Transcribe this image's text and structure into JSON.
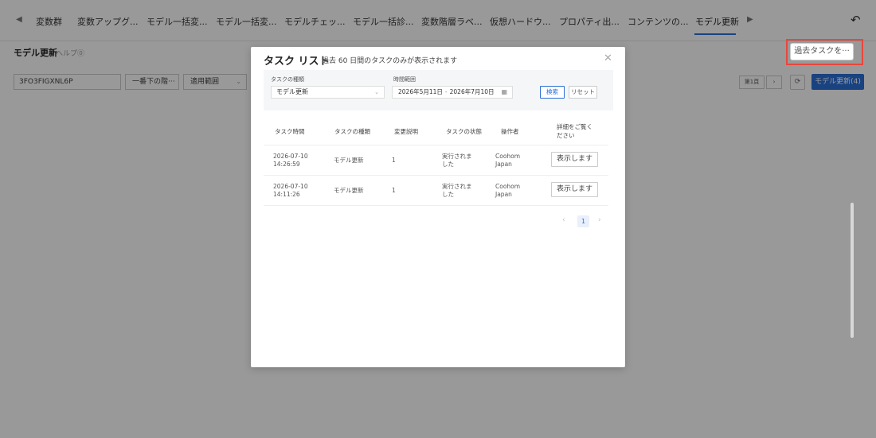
{
  "tabs": {
    "items": [
      {
        "label": "変数群"
      },
      {
        "label": "変数アップグ..."
      },
      {
        "label": "モデル一括変..."
      },
      {
        "label": "モデル一括変..."
      },
      {
        "label": "モデルチェッ..."
      },
      {
        "label": "モデル一括診..."
      },
      {
        "label": "変数階層ラベ..."
      },
      {
        "label": "仮想ハードウ..."
      },
      {
        "label": "プロパティ出..."
      },
      {
        "label": "コンテンツの..."
      },
      {
        "label": "モデル更新"
      }
    ],
    "active": "モデル更新",
    "prev_icon": "◀",
    "next_icon": "▶",
    "undo_icon": "↶"
  },
  "page": {
    "title": "モデル更新",
    "help": "ヘルプ⓪",
    "past_tasks_button": "過去タスクを···"
  },
  "filters": {
    "id_value": "3FO3FIGXNL6P",
    "order_select": "一番下の階···",
    "scope_select": "適用範囲",
    "page_mini": "第1頁",
    "refresh_icon": "⟳",
    "model_update_button": "モデル更新(4)"
  },
  "modal": {
    "title": "タスク リスト",
    "subtitle": "過去 60 日間のタスクのみが表示されます",
    "close_icon": "✕",
    "filter": {
      "type_label": "タスクの種類",
      "type_value": "モデル更新",
      "range_label": "時間範囲",
      "date_start": "2026年5月11日",
      "date_end": "2026年7月10日",
      "search_button": "検索",
      "reset_button": "リセット"
    },
    "table": {
      "headers": [
        "タスク時間",
        "タスクの種類",
        "変更説明",
        "タスクの状態",
        "操作者",
        "詳細をご覧ください"
      ],
      "rows": [
        {
          "date": "2026-07-10",
          "time": "14:26:59",
          "type": "モデル更新",
          "desc": "1",
          "status": "実行されました",
          "operator": "Coohom Japan",
          "action": "表示します"
        },
        {
          "date": "2026-07-10",
          "time": "14:11:26",
          "type": "モデル更新",
          "desc": "1",
          "status": "実行されました",
          "operator": "Coohom Japan",
          "action": "表示します"
        }
      ]
    },
    "pagination": {
      "current": "1",
      "prev_icon": "‹",
      "next_icon": "›"
    }
  },
  "colors": {
    "accent": "#2b6fd6",
    "highlight": "#e8463c"
  }
}
